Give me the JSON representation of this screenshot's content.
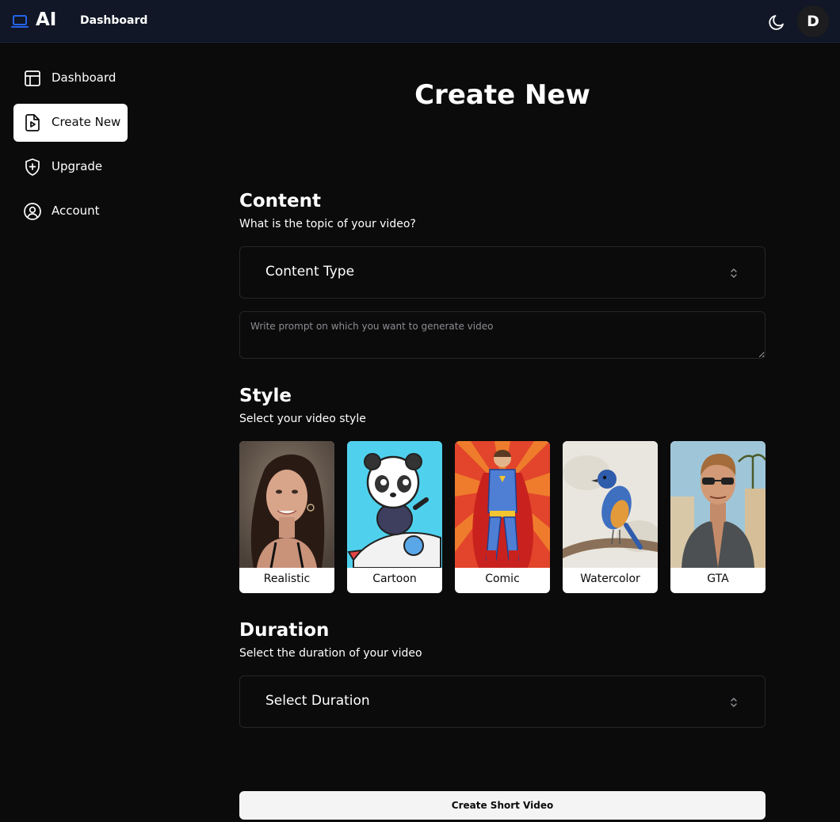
{
  "header": {
    "logo_text": "AI",
    "logo_icon": "laptop-icon",
    "nav_link": "Dashboard",
    "theme_icon": "moon-icon",
    "avatar_initial": "D",
    "accent_color": "#2563eb"
  },
  "sidebar": {
    "items": [
      {
        "label": "Dashboard",
        "icon": "layout-icon",
        "active": false
      },
      {
        "label": "Create New",
        "icon": "file-video-icon",
        "active": true
      },
      {
        "label": "Upgrade",
        "icon": "shield-plus-icon",
        "active": false
      },
      {
        "label": "Account",
        "icon": "user-circle-icon",
        "active": false
      }
    ]
  },
  "main": {
    "title": "Create New",
    "content": {
      "heading": "Content",
      "subheading": "What is the topic of your video?",
      "select_value": "Content Type",
      "prompt_placeholder": "Write prompt on which you want to generate video"
    },
    "style": {
      "heading": "Style",
      "subheading": "Select your video style",
      "options": [
        {
          "label": "Realistic"
        },
        {
          "label": "Cartoon"
        },
        {
          "label": "Comic"
        },
        {
          "label": "Watercolor"
        },
        {
          "label": "GTA"
        }
      ]
    },
    "duration": {
      "heading": "Duration",
      "subheading": "Select the duration of your video",
      "select_value": "Select Duration"
    },
    "submit_label": "Create Short Video"
  }
}
